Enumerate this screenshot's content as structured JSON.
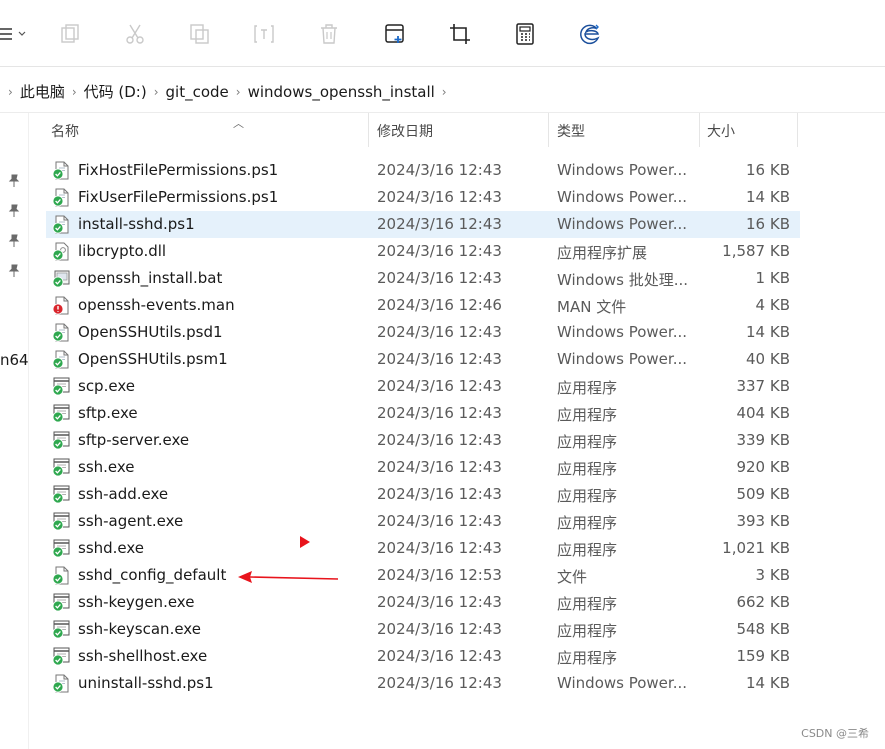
{
  "toolbar": {
    "buttons": [
      {
        "name": "view-menu-icon"
      },
      {
        "name": "new-icon"
      },
      {
        "name": "cut-icon"
      },
      {
        "name": "copy-icon"
      },
      {
        "name": "rename-icon"
      },
      {
        "name": "delete-icon"
      },
      {
        "name": "new-window-icon"
      },
      {
        "name": "crop-icon"
      },
      {
        "name": "calculator-icon"
      },
      {
        "name": "edge-icon"
      }
    ]
  },
  "breadcrumb": {
    "items": [
      "此电脑",
      "代码 (D:)",
      "git_code",
      "windows_openssh_install"
    ]
  },
  "sidebar": {
    "partial_label": "n64"
  },
  "columns": {
    "name": "名称",
    "date": "修改日期",
    "type": "类型",
    "size": "大小"
  },
  "files": [
    {
      "name": "FixHostFilePermissions.ps1",
      "date": "2024/3/16 12:43",
      "type": "Windows Power...",
      "size": "16 KB",
      "icon": "script"
    },
    {
      "name": "FixUserFilePermissions.ps1",
      "date": "2024/3/16 12:43",
      "type": "Windows Power...",
      "size": "14 KB",
      "icon": "script"
    },
    {
      "name": "install-sshd.ps1",
      "date": "2024/3/16 12:43",
      "type": "Windows Power...",
      "size": "16 KB",
      "icon": "script",
      "selected": true
    },
    {
      "name": "libcrypto.dll",
      "date": "2024/3/16 12:43",
      "type": "应用程序扩展",
      "size": "1,587 KB",
      "icon": "dll"
    },
    {
      "name": "openssh_install.bat",
      "date": "2024/3/16 12:43",
      "type": "Windows 批处理...",
      "size": "1 KB",
      "icon": "bat"
    },
    {
      "name": "openssh-events.man",
      "date": "2024/3/16 12:46",
      "type": "MAN 文件",
      "size": "4 KB",
      "icon": "error"
    },
    {
      "name": "OpenSSHUtils.psd1",
      "date": "2024/3/16 12:43",
      "type": "Windows Power...",
      "size": "14 KB",
      "icon": "script"
    },
    {
      "name": "OpenSSHUtils.psm1",
      "date": "2024/3/16 12:43",
      "type": "Windows Power...",
      "size": "40 KB",
      "icon": "script"
    },
    {
      "name": "scp.exe",
      "date": "2024/3/16 12:43",
      "type": "应用程序",
      "size": "337 KB",
      "icon": "exe"
    },
    {
      "name": "sftp.exe",
      "date": "2024/3/16 12:43",
      "type": "应用程序",
      "size": "404 KB",
      "icon": "exe"
    },
    {
      "name": "sftp-server.exe",
      "date": "2024/3/16 12:43",
      "type": "应用程序",
      "size": "339 KB",
      "icon": "exe"
    },
    {
      "name": "ssh.exe",
      "date": "2024/3/16 12:43",
      "type": "应用程序",
      "size": "920 KB",
      "icon": "exe"
    },
    {
      "name": "ssh-add.exe",
      "date": "2024/3/16 12:43",
      "type": "应用程序",
      "size": "509 KB",
      "icon": "exe"
    },
    {
      "name": "ssh-agent.exe",
      "date": "2024/3/16 12:43",
      "type": "应用程序",
      "size": "393 KB",
      "icon": "exe"
    },
    {
      "name": "sshd.exe",
      "date": "2024/3/16 12:43",
      "type": "应用程序",
      "size": "1,021 KB",
      "icon": "exe"
    },
    {
      "name": "sshd_config_default",
      "date": "2024/3/16 12:53",
      "type": "文件",
      "size": "3 KB",
      "icon": "file"
    },
    {
      "name": "ssh-keygen.exe",
      "date": "2024/3/16 12:43",
      "type": "应用程序",
      "size": "662 KB",
      "icon": "exe"
    },
    {
      "name": "ssh-keyscan.exe",
      "date": "2024/3/16 12:43",
      "type": "应用程序",
      "size": "548 KB",
      "icon": "exe"
    },
    {
      "name": "ssh-shellhost.exe",
      "date": "2024/3/16 12:43",
      "type": "应用程序",
      "size": "159 KB",
      "icon": "exe"
    },
    {
      "name": "uninstall-sshd.ps1",
      "date": "2024/3/16 12:43",
      "type": "Windows Power...",
      "size": "14 KB",
      "icon": "script"
    }
  ],
  "selection_color": "#e5f1fb",
  "annotation_color": "#e8141c",
  "watermark": "CSDN @三希"
}
